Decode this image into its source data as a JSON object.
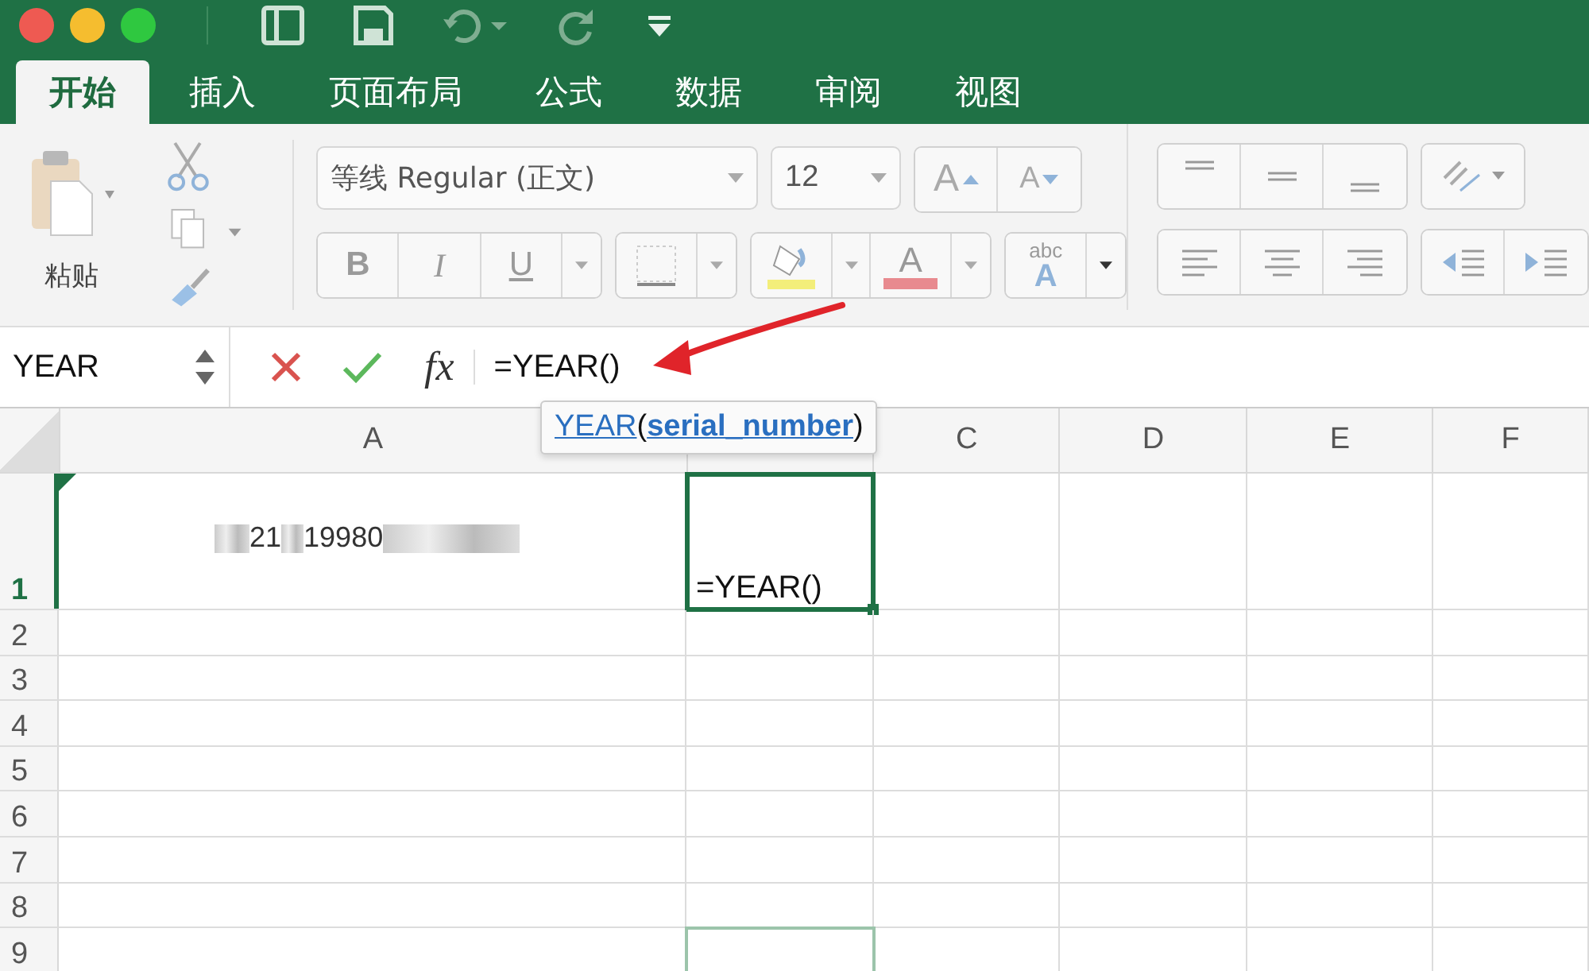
{
  "window": {
    "traffic_lights": [
      {
        "color": "#ee5a52"
      },
      {
        "color": "#f5bd2f"
      },
      {
        "color": "#2fc840"
      }
    ]
  },
  "tabs": [
    {
      "label": "开始",
      "selected": true
    },
    {
      "label": "插入",
      "selected": false
    },
    {
      "label": "页面布局",
      "selected": false
    },
    {
      "label": "公式",
      "selected": false
    },
    {
      "label": "数据",
      "selected": false
    },
    {
      "label": "审阅",
      "selected": false
    },
    {
      "label": "视图",
      "selected": false
    }
  ],
  "ribbon": {
    "paste_label": "粘贴",
    "font_name": "等线 Regular (正文)",
    "font_size": "12",
    "grow_label": "A",
    "shrink_label": "A",
    "bold": "B",
    "italic": "I",
    "underline": "U",
    "font_color_label": "A",
    "phonetic_top": "abc",
    "phonetic_bottom": "A"
  },
  "formula_bar": {
    "name_box": "YEAR",
    "fx": "fx",
    "formula": "=YEAR()"
  },
  "tooltip": {
    "function": "YEAR",
    "open": "(",
    "argument": "serial_number",
    "close": ")"
  },
  "sheet": {
    "columns": [
      {
        "label": "A"
      },
      {},
      {
        "label": "C"
      },
      {
        "label": "D"
      },
      {
        "label": "E"
      },
      {
        "label": "F"
      }
    ],
    "rows": [
      {
        "number": "1",
        "selected": true,
        "cells": [
          {
            "text": "21",
            "suffix": "19980",
            "kind": "masked"
          },
          {
            "text": "=YEAR()",
            "kind": "active"
          }
        ]
      },
      {
        "number": "2",
        "selected": false,
        "cells": []
      },
      {
        "number": "3",
        "selected": false,
        "cells": []
      },
      {
        "number": "4",
        "selected": false,
        "cells": []
      },
      {
        "number": "5",
        "selected": false,
        "cells": []
      },
      {
        "number": "6",
        "selected": false,
        "cells": []
      },
      {
        "number": "7",
        "selected": false,
        "cells": []
      },
      {
        "number": "8",
        "selected": false,
        "cells": []
      },
      {
        "number": "9",
        "selected": false,
        "cells": [
          {
            "kind": "outlined"
          }
        ]
      }
    ]
  }
}
